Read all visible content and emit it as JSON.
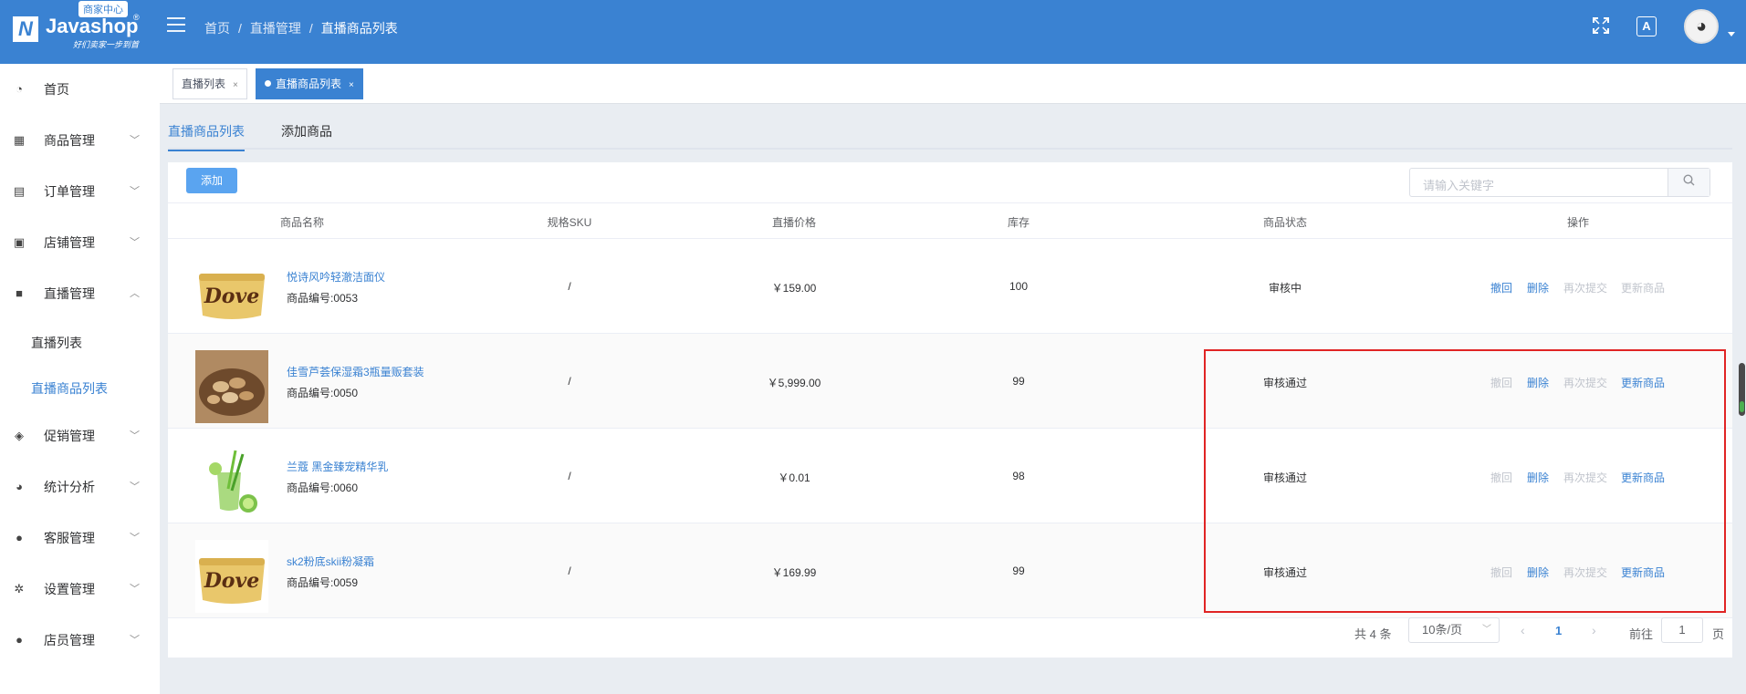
{
  "logo": {
    "mark": "N",
    "name": "Javashop",
    "badge": "商家中心",
    "reg": "®",
    "slogan": "好们卖家一步到首"
  },
  "breadcrumb": [
    "首页",
    "直播管理",
    "直播商品列表"
  ],
  "sidebar": {
    "items": [
      {
        "label": "首页",
        "icon": "dashboard-icon"
      },
      {
        "label": "商品管理",
        "icon": "grid-icon"
      },
      {
        "label": "订单管理",
        "icon": "clipboard-icon"
      },
      {
        "label": "店铺管理",
        "icon": "store-icon"
      },
      {
        "label": "直播管理",
        "icon": "video-icon"
      },
      {
        "label": "促销管理",
        "icon": "tag-icon"
      },
      {
        "label": "统计分析",
        "icon": "pie-chart-icon"
      },
      {
        "label": "客服管理",
        "icon": "user-icon"
      },
      {
        "label": "设置管理",
        "icon": "gear-icon"
      },
      {
        "label": "店员管理",
        "icon": "users-icon"
      }
    ],
    "sub": [
      "直播列表",
      "直播商品列表"
    ]
  },
  "tags": [
    {
      "label": "直播列表"
    },
    {
      "label": "直播商品列表"
    }
  ],
  "subtabs": [
    "直播商品列表",
    "添加商品"
  ],
  "toolbar": {
    "add_label": "添加",
    "search_placeholder": "请输入关键字"
  },
  "table": {
    "headers": [
      "商品名称",
      "规格SKU",
      "直播价格",
      "库存",
      "商品状态",
      "操作"
    ],
    "rows": [
      {
        "name": "悦诗风吟轻澈洁面仪",
        "code": "商品编号:0053",
        "sku": "/",
        "price": "￥159.00",
        "stock": "100",
        "status": "审核中",
        "thumb": "dove",
        "ops": [
          {
            "label": "撤回",
            "enabled": true
          },
          {
            "label": "删除",
            "enabled": true
          },
          {
            "label": "再次提交",
            "enabled": false
          },
          {
            "label": "更新商品",
            "enabled": false
          }
        ]
      },
      {
        "name": "佳雪芦荟保湿霜3瓶量贩套装",
        "code": "商品编号:0050",
        "sku": "/",
        "price": "￥5,999.00",
        "stock": "99",
        "status": "审核通过",
        "thumb": "nuts",
        "ops": [
          {
            "label": "撤回",
            "enabled": false
          },
          {
            "label": "删除",
            "enabled": true
          },
          {
            "label": "再次提交",
            "enabled": false
          },
          {
            "label": "更新商品",
            "enabled": true
          }
        ]
      },
      {
        "name": "兰蔻 黑金臻宠精华乳",
        "code": "商品编号:0060",
        "sku": "/",
        "price": "￥0.01",
        "stock": "98",
        "status": "审核通过",
        "thumb": "lime",
        "ops": [
          {
            "label": "撤回",
            "enabled": false
          },
          {
            "label": "删除",
            "enabled": true
          },
          {
            "label": "再次提交",
            "enabled": false
          },
          {
            "label": "更新商品",
            "enabled": true
          }
        ]
      },
      {
        "name": "sk2粉底skii粉凝霜",
        "code": "商品编号:0059",
        "sku": "/",
        "price": "￥169.99",
        "stock": "99",
        "status": "审核通过",
        "thumb": "dove",
        "ops": [
          {
            "label": "撤回",
            "enabled": false
          },
          {
            "label": "删除",
            "enabled": true
          },
          {
            "label": "再次提交",
            "enabled": false
          },
          {
            "label": "更新商品",
            "enabled": true
          }
        ]
      }
    ]
  },
  "pagination": {
    "total": "共 4 条",
    "page_size": "10条/页",
    "current": "1",
    "goto_label": "前往",
    "goto_value": "1",
    "page_label": "页"
  },
  "colors": {
    "primary": "#3a82d2",
    "highlight": "#e02424"
  }
}
